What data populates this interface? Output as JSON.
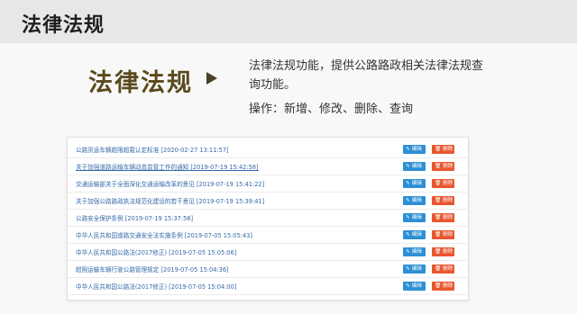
{
  "header": {
    "title": "法律法规"
  },
  "feature": {
    "title": "法律法规",
    "description": "法律法规功能，提供公路路政相关法律法规查询功能。",
    "operations": "操作：新增、修改、删除、查询"
  },
  "buttons": {
    "edit_label": "编辑",
    "delete_label": "删除"
  },
  "regulations": [
    {
      "title": "公路货运车辆超限超载认定标准",
      "date": "[2020-02-27 13:11:57]"
    },
    {
      "title": "关于加强道路运输车辆动态监管工作的通知",
      "date": "[2019-07-19 15:42:58]"
    },
    {
      "title": "交通运输部关于全面深化交通运输改革的意见",
      "date": "[2019-07-19 15:41:22]"
    },
    {
      "title": "关于加强公路路政执法规范化建设的若干意见",
      "date": "[2019-07-19 15:39:41]"
    },
    {
      "title": "公路安全保护条例",
      "date": "[2019-07-19 15:37:58]"
    },
    {
      "title": "中华人民共和国道路交通安全法实施条例",
      "date": "[2019-07-05 15:05:43]"
    },
    {
      "title": "中华人民共和国公路法(2017修正)",
      "date": "[2019-07-05 15:05:06]"
    },
    {
      "title": "超限运输车辆行驶公路管理规定",
      "date": "[2019-07-05 15:04:36]"
    },
    {
      "title": "中华人民共和国公路法(2017修正)",
      "date": "[2019-07-05 15:04:00]"
    }
  ]
}
